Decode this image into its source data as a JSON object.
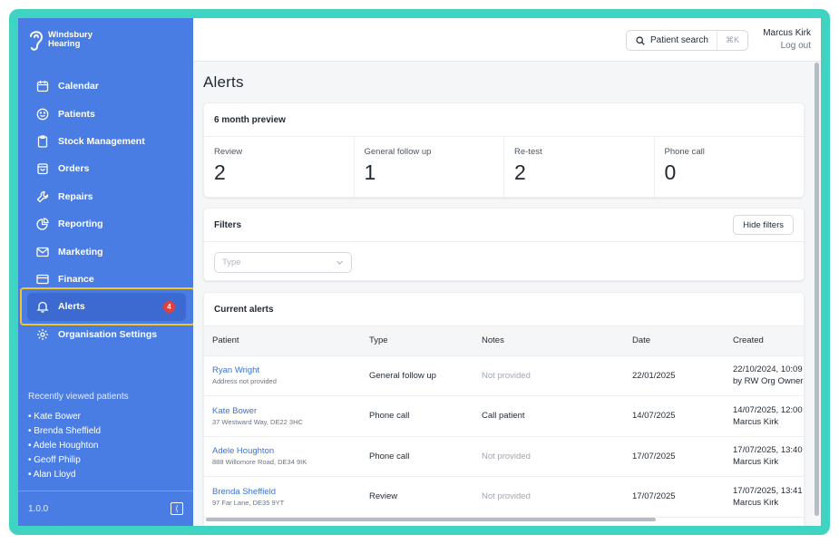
{
  "brand": {
    "line1": "Windsbury",
    "line2": "Hearing"
  },
  "nav": [
    {
      "label": "Calendar",
      "icon": "calendar-icon"
    },
    {
      "label": "Patients",
      "icon": "smile-icon"
    },
    {
      "label": "Stock Management",
      "icon": "clipboard-icon"
    },
    {
      "label": "Orders",
      "icon": "shopping-bag-icon"
    },
    {
      "label": "Repairs",
      "icon": "wrench-icon"
    },
    {
      "label": "Reporting",
      "icon": "pie-chart-icon"
    },
    {
      "label": "Marketing",
      "icon": "mail-icon"
    },
    {
      "label": "Finance",
      "icon": "credit-card-icon"
    },
    {
      "label": "Alerts",
      "icon": "bell-icon",
      "badge": "4",
      "active": true
    },
    {
      "label": "Organisation Settings",
      "icon": "gear-icon"
    }
  ],
  "recent": {
    "title": "Recently viewed patients",
    "items": [
      "• Kate Bower",
      "• Brenda Sheffield",
      "• Adele Houghton",
      "• Geoff Philip",
      "• Alan Lloyd"
    ]
  },
  "version": "1.0.0",
  "topbar": {
    "search_label": "Patient search",
    "search_shortcut": "⌘K",
    "user_name": "Marcus Kirk",
    "logout_label": "Log out"
  },
  "page_title": "Alerts",
  "preview": {
    "title": "6 month preview",
    "stats": [
      {
        "label": "Review",
        "value": "2"
      },
      {
        "label": "General follow up",
        "value": "1"
      },
      {
        "label": "Re-test",
        "value": "2"
      },
      {
        "label": "Phone call",
        "value": "0"
      }
    ]
  },
  "filters": {
    "title": "Filters",
    "hide_label": "Hide filters",
    "type_placeholder": "Type"
  },
  "alerts": {
    "title": "Current alerts",
    "columns": [
      "Patient",
      "Type",
      "Notes",
      "Date",
      "Created"
    ],
    "rows": [
      {
        "name": "Ryan Wright",
        "address": "Address not provided",
        "type": "General follow up",
        "notes": "Not provided",
        "notes_muted": true,
        "date": "22/01/2025",
        "created1": "22/10/2024, 10:09",
        "created2": "by RW Org Owner"
      },
      {
        "name": "Kate Bower",
        "address": "37 Westward Way, DE22 3HC",
        "type": "Phone call",
        "notes": "Call patient",
        "notes_muted": false,
        "date": "14/07/2025",
        "created1": "14/07/2025, 12:00",
        "created2": "Marcus Kirk"
      },
      {
        "name": "Adele Houghton",
        "address": "888 Willomore Road, DE34 9IK",
        "type": "Phone call",
        "notes": "Not provided",
        "notes_muted": true,
        "date": "17/07/2025",
        "created1": "17/07/2025, 13:40",
        "created2": "Marcus Kirk"
      },
      {
        "name": "Brenda Sheffield",
        "address": "97 Far Lane, DE35 9YT",
        "type": "Review",
        "notes": "Not provided",
        "notes_muted": true,
        "date": "17/07/2025",
        "created1": "17/07/2025, 13:41",
        "created2": "Marcus Kirk"
      }
    ]
  },
  "colors": {
    "sidebar": "#4a7de4",
    "frame": "#3fd3c1",
    "highlight": "#f3c623",
    "badge": "#e0423b",
    "link": "#3b72d8"
  }
}
